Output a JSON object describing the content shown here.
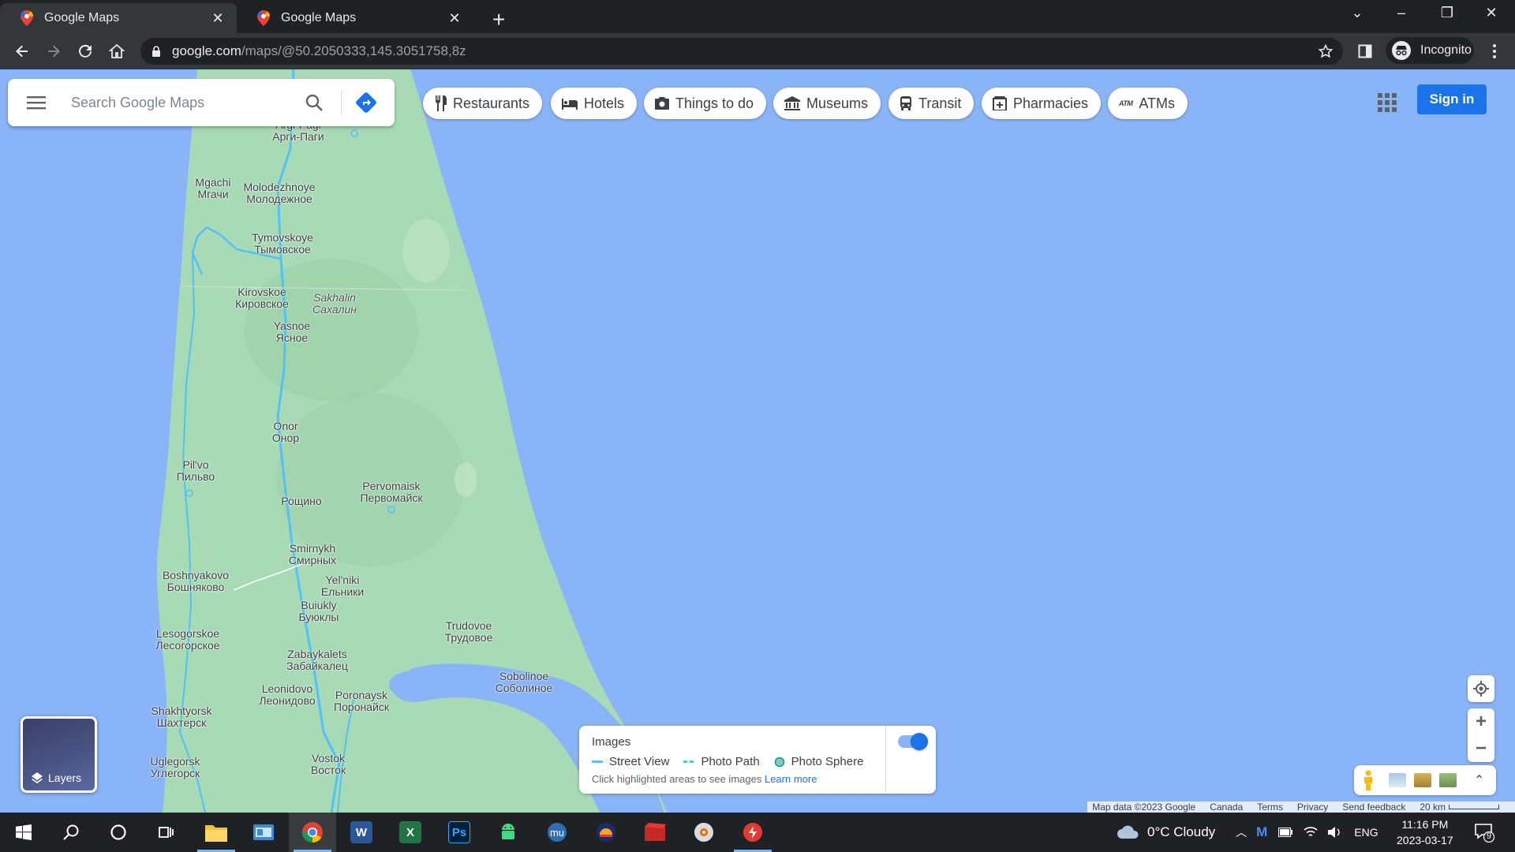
{
  "browser": {
    "tabs": [
      {
        "title": "Google Maps",
        "active": true
      },
      {
        "title": "Google Maps",
        "active": false
      }
    ],
    "url_host": "google.com",
    "url_path": "/maps/@50.2050333,145.3051758,8z",
    "profile_label": "Incognito",
    "icons": [
      "back-arrow-icon",
      "forward-arrow-icon",
      "reload-icon",
      "home-icon",
      "lock-icon",
      "star-icon",
      "sidepanel-icon",
      "incognito-icon",
      "kebab-menu-icon"
    ]
  },
  "maps": {
    "search_placeholder": "Search Google Maps",
    "chips": [
      {
        "label": "Restaurants",
        "icon": "fork-knife-icon"
      },
      {
        "label": "Hotels",
        "icon": "bed-icon"
      },
      {
        "label": "Things to do",
        "icon": "camera-icon"
      },
      {
        "label": "Museums",
        "icon": "museum-icon"
      },
      {
        "label": "Transit",
        "icon": "bus-icon"
      },
      {
        "label": "Pharmacies",
        "icon": "pharmacy-icon"
      },
      {
        "label": "ATMs",
        "icon": "atm-icon"
      }
    ],
    "sign_in": "Sign in",
    "layers_label": "Layers",
    "places": [
      {
        "name": "Argi-Pagi",
        "local": "Арги-Паги"
      },
      {
        "name": "Mgachi",
        "local": "Мгачи"
      },
      {
        "name": "Molodezhnoye",
        "local": "Молодежное"
      },
      {
        "name": "Tymovskoye",
        "local": "Тымовское"
      },
      {
        "name": "Kirovskoe",
        "local": "Кировское"
      },
      {
        "name": "Sakhalin",
        "local": "Сахалин"
      },
      {
        "name": "Yasnoe",
        "local": "Ясное"
      },
      {
        "name": "Onor",
        "local": "Онор"
      },
      {
        "name": "Pil'vo",
        "local": "Пильво"
      },
      {
        "name": "Pervomaisk",
        "local": "Первомайск"
      },
      {
        "name": "",
        "local": "Рощино"
      },
      {
        "name": "Smirnykh",
        "local": "Смирных"
      },
      {
        "name": "Boshnyakovo",
        "local": "Бошняково"
      },
      {
        "name": "Yel'niki",
        "local": "Ельники"
      },
      {
        "name": "Buiukly",
        "local": "Буюклы"
      },
      {
        "name": "Lesogorskoe",
        "local": "Лесогорское"
      },
      {
        "name": "Trudovoe",
        "local": "Трудовое"
      },
      {
        "name": "Zabaykalets",
        "local": "Забайкалец"
      },
      {
        "name": "Sobolinoe",
        "local": "Соболиное"
      },
      {
        "name": "Leonidovo",
        "local": "Леонидово"
      },
      {
        "name": "Poronaysk",
        "local": "Поронайск"
      },
      {
        "name": "Shakhtyorsk",
        "local": "Шахтерск"
      },
      {
        "name": "Vostok",
        "local": "Восток"
      },
      {
        "name": "Uglegorsk",
        "local": "Углегорск"
      }
    ],
    "images_panel": {
      "title": "Images",
      "legend": [
        "Street View",
        "Photo Path",
        "Photo Sphere"
      ],
      "hint": "Click highlighted areas to see images",
      "learn_more": "Learn more",
      "toggle_on": true
    },
    "attribution": [
      "Map data ©2023 Google",
      "Canada",
      "Terms",
      "Privacy",
      "Send feedback",
      "20 km"
    ],
    "colors": {
      "water": "#8ab4f8",
      "land": "#a8dab5",
      "road": "#4fc3f7",
      "accent": "#1a73e8"
    }
  },
  "taskbar": {
    "apps": [
      "windows-start-icon",
      "search-icon",
      "cortana-icon",
      "task-view-icon",
      "file-explorer-icon",
      "control-panel-icon",
      "chrome-icon",
      "word-icon",
      "excel-icon",
      "photoshop-icon",
      "android-icon",
      "mu-icon",
      "vpn-icon",
      "video-app-icon",
      "media-player-icon",
      "power-app-icon"
    ],
    "word_letter": "W",
    "excel_letter": "X",
    "ps_letter": "Ps",
    "weather": "0°C  Cloudy",
    "language": "ENG",
    "time": "11:16 PM",
    "date": "2023-03-17",
    "notifications": "9"
  }
}
